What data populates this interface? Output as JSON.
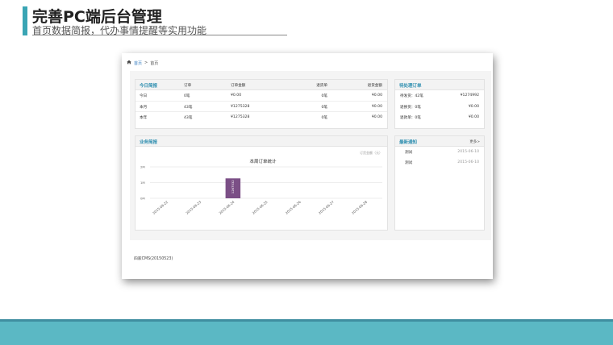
{
  "slide": {
    "title": "完善PC端后台管理",
    "subtitle": "首页数据简报，代办事情提醒等实用功能"
  },
  "breadcrumb": {
    "home": "首页",
    "separator": ">",
    "current": "首页"
  },
  "stats": {
    "title": "今日简报",
    "columns": [
      "订单",
      "订单金额",
      "退货单",
      "退货金额"
    ],
    "rows": [
      [
        "今日",
        "0笔",
        "¥0.00",
        "0笔",
        "¥0.00"
      ],
      [
        "本月",
        "43笔",
        "¥1275328",
        "0笔",
        "¥0.00"
      ],
      [
        "本年",
        "43笔",
        "¥1275328",
        "0笔",
        "¥0.00"
      ]
    ]
  },
  "pending": {
    "title": "待处理订单",
    "rows": [
      [
        "待发货：42笔",
        "¥1274992"
      ],
      [
        "退换货：0笔",
        "¥0.00"
      ],
      [
        "退款单：0笔",
        "¥0.00"
      ]
    ]
  },
  "business": {
    "title": "业务简报",
    "legend": "订货金额（元）"
  },
  "notices": {
    "title": "最新通知",
    "more": "更多>",
    "items": [
      {
        "title": "测试",
        "date": "2015-06-10"
      },
      {
        "title": "测试",
        "date": "2015-06-10"
      }
    ]
  },
  "footer": {
    "copyright": "四家CMS(20150523)"
  },
  "chart_data": {
    "type": "bar",
    "title": "本周订单统计",
    "legend": "订货金额（元）",
    "categories": [
      "2015-06-22",
      "2015-06-23",
      "2015-06-24",
      "2015-06-25",
      "2015-06-26",
      "2015-06-27",
      "2015-06-28"
    ],
    "values": [
      0,
      0,
      1267532,
      0,
      0,
      0,
      0
    ],
    "value_labels": [
      "",
      "",
      "1267532",
      "",
      "",
      "",
      ""
    ],
    "yticks": [
      "0M",
      "1M",
      "2M"
    ],
    "ylim": [
      0,
      2000000
    ],
    "bar_color": "#7b4f86",
    "grid": true
  }
}
